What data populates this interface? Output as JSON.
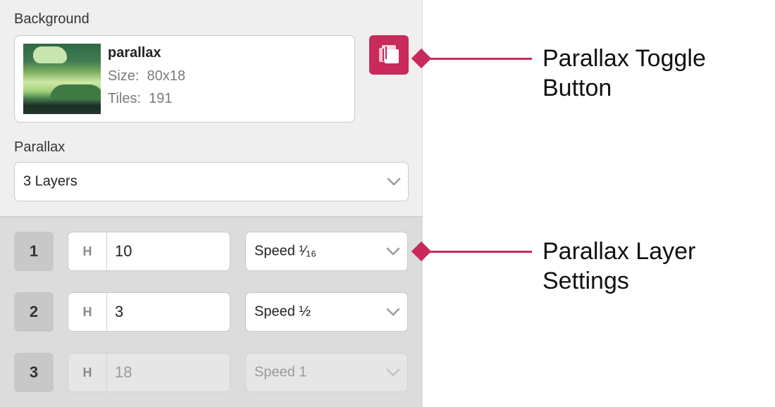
{
  "background": {
    "label": "Background",
    "name": "parallax",
    "size_label": "Size:",
    "size_value": "80x18",
    "tiles_label": "Tiles:",
    "tiles_value": "191"
  },
  "parallax": {
    "label": "Parallax",
    "selected": "3 Layers"
  },
  "layers": [
    {
      "number": "1",
      "h_label": "H",
      "h_value": "10",
      "speed": "Speed ¹⁄₁₆",
      "enabled": true
    },
    {
      "number": "2",
      "h_label": "H",
      "h_value": "3",
      "speed": "Speed ½",
      "enabled": true
    },
    {
      "number": "3",
      "h_label": "H",
      "h_value": "18",
      "speed": "Speed 1",
      "enabled": false
    }
  ],
  "callouts": {
    "toggle": [
      "Parallax Toggle",
      "Button"
    ],
    "layers": [
      "Parallax Layer",
      "Settings"
    ]
  },
  "colors": {
    "accent": "#c82a5c",
    "panel": "#efefef",
    "layer_panel": "#dcdcdc"
  },
  "icons": {
    "toggle": "layers-icon",
    "dropdown": "chevron-down-icon"
  }
}
